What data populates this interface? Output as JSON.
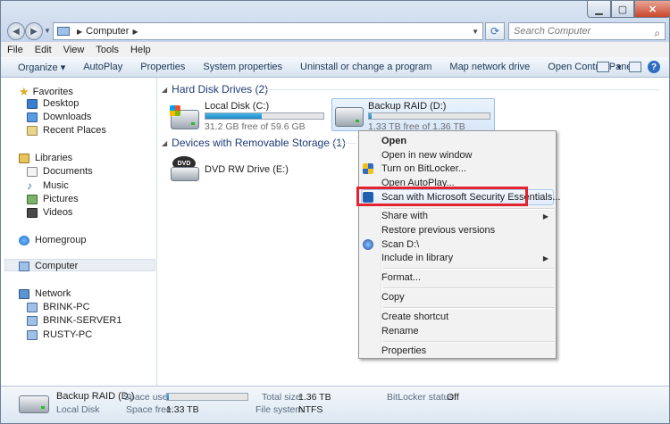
{
  "window": {
    "address": "Computer",
    "search_placeholder": "Search Computer",
    "controls": {
      "minimize": "▁",
      "maximize": "▢",
      "close": "✕"
    }
  },
  "menubar": [
    "File",
    "Edit",
    "View",
    "Tools",
    "Help"
  ],
  "toolbar": {
    "organize": "Organize ▾",
    "commands": [
      "AutoPlay",
      "Properties",
      "System properties",
      "Uninstall or change a program",
      "Map network drive",
      "Open Control Panel"
    ]
  },
  "nav": {
    "favorites": "Favorites",
    "favorites_items": [
      "Desktop",
      "Downloads",
      "Recent Places"
    ],
    "libraries": "Libraries",
    "libraries_items": [
      "Documents",
      "Music",
      "Pictures",
      "Videos"
    ],
    "homegroup": "Homegroup",
    "computer": "Computer",
    "network": "Network",
    "network_items": [
      "BRINK-PC",
      "BRINK-SERVER1",
      "RUSTY-PC"
    ]
  },
  "content": {
    "group_hdd": "Hard Disk Drives (2)",
    "group_removable": "Devices with Removable Storage (1)",
    "drives": [
      {
        "name": "Local Disk (C:)",
        "free": "31.2 GB free of 59.6 GB",
        "used_fraction": 0.48
      },
      {
        "name": "Backup RAID (D:)",
        "free": "1.33 TB free of 1.36 TB",
        "used_fraction": 0.02
      }
    ],
    "dvd": {
      "name": "DVD RW Drive (E:)",
      "disc_label": "DVD"
    }
  },
  "context_menu": {
    "open": "Open",
    "open_new_window": "Open in new window",
    "bitlocker": "Turn on BitLocker...",
    "autoplay": "Open AutoPlay...",
    "scan_mse": "Scan with Microsoft Security Essentials...",
    "share_with": "Share with",
    "restore": "Restore previous versions",
    "scan_d": "Scan D:\\",
    "include_library": "Include in library",
    "format": "Format...",
    "copy": "Copy",
    "create_shortcut": "Create shortcut",
    "rename": "Rename",
    "properties": "Properties"
  },
  "details": {
    "name": "Backup RAID (D:)",
    "type": "Local Disk",
    "space_used_label": "Space used:",
    "space_used_fraction": 0.02,
    "space_free_label": "Space free:",
    "space_free": "1.33 TB",
    "total_size_label": "Total size:",
    "total_size": "1.36 TB",
    "file_system_label": "File system:",
    "file_system": "NTFS",
    "bitlocker_label": "BitLocker status:",
    "bitlocker_value": "Off"
  },
  "colors": {
    "accent": "#1f87c8",
    "highlight_box": "#e3232e",
    "group_header": "#1e3a77"
  }
}
